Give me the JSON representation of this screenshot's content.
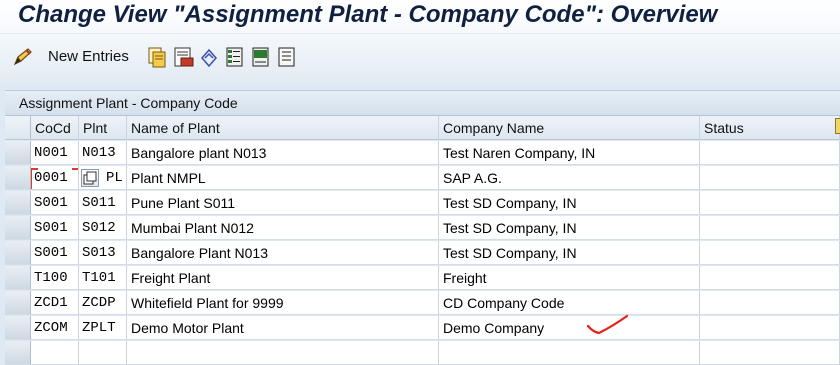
{
  "title": "Change View \"Assignment Plant - Company Code\": Overview",
  "toolbar": {
    "new_entries_label": "New Entries",
    "icons": [
      "edit-pencil-icon",
      "copy-icon",
      "delete-icon",
      "undo-icon",
      "select-all-icon",
      "select-block-icon",
      "deselect-all-icon"
    ]
  },
  "panel": {
    "title": "Assignment Plant - Company Code"
  },
  "table": {
    "headers": {
      "cocd": "CoCd",
      "plnt": "Plnt",
      "name": "Name of Plant",
      "company": "Company Name",
      "status": "Status"
    },
    "rows": [
      {
        "cocd": "N001",
        "plnt": "N013",
        "name": "Bangalore plant N013",
        "company": "Test Naren Company, IN",
        "status": ""
      },
      {
        "cocd": "0001",
        "plnt": "PL",
        "name": "Plant NMPL",
        "company": "SAP A.G.",
        "status": ""
      },
      {
        "cocd": "S001",
        "plnt": "S011",
        "name": "Pune Plant S011",
        "company": "Test SD Company, IN",
        "status": ""
      },
      {
        "cocd": "S001",
        "plnt": "S012",
        "name": "Mumbai Plant N012",
        "company": "Test SD Company, IN",
        "status": ""
      },
      {
        "cocd": "S001",
        "plnt": "S013",
        "name": "Bangalore Plant N013",
        "company": "Test SD Company, IN",
        "status": ""
      },
      {
        "cocd": "T100",
        "plnt": "T101",
        "name": "Freight Plant",
        "company": "Freight",
        "status": ""
      },
      {
        "cocd": "ZCD1",
        "plnt": "ZCDP",
        "name": "Whitefield Plant for 9999",
        "company": "CD Company Code",
        "status": ""
      },
      {
        "cocd": "ZCOM",
        "plnt": "ZPLT",
        "name": "Demo Motor Plant",
        "company": "Demo Company",
        "status": ""
      },
      {
        "cocd": "",
        "plnt": "",
        "name": "",
        "company": "",
        "status": ""
      }
    ]
  },
  "colors": {
    "focus": "#e23a2a",
    "annotation": "#e8221b",
    "title": "#102040"
  }
}
